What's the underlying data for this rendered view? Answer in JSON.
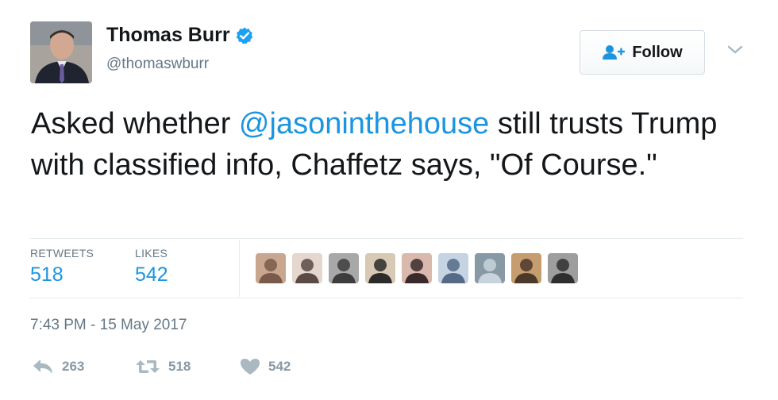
{
  "author": {
    "name": "Thomas Burr",
    "handle": "@thomaswburr",
    "verified": true,
    "verified_color": "#1da1f2"
  },
  "follow_button": {
    "label": "Follow",
    "icon": "add-user-icon"
  },
  "tweet": {
    "text_before": "Asked whether ",
    "mention": "@jasoninthehouse",
    "text_after": " still trusts Trump with classified info, Chaffetz says, \"Of Course.\""
  },
  "stats": {
    "retweets_label": "RETWEETS",
    "retweets_value": "518",
    "likes_label": "LIKES",
    "likes_value": "542"
  },
  "likers": [
    {
      "name": "liker-avatar-1",
      "colors": [
        "#7a5a4a",
        "#c9a78f"
      ]
    },
    {
      "name": "liker-avatar-2",
      "colors": [
        "#5b4a45",
        "#e5d6ce"
      ]
    },
    {
      "name": "liker-avatar-3",
      "colors": [
        "#3d3d3d",
        "#a8a8a8"
      ]
    },
    {
      "name": "liker-avatar-4",
      "colors": [
        "#2b2b2b",
        "#d8c9b5"
      ]
    },
    {
      "name": "liker-avatar-5",
      "colors": [
        "#3a2b2b",
        "#d9b8ad"
      ]
    },
    {
      "name": "liker-avatar-6",
      "colors": [
        "#546a86",
        "#c6d3e2"
      ]
    },
    {
      "name": "liker-avatar-7",
      "colors": [
        "#c9d3db",
        "#8899a6"
      ]
    },
    {
      "name": "liker-avatar-8",
      "colors": [
        "#4b3a2c",
        "#c59d6f"
      ]
    },
    {
      "name": "liker-avatar-9",
      "colors": [
        "#2f2f2f",
        "#9e9e9e"
      ]
    }
  ],
  "timestamp": "7:43 PM - 15 May 2017",
  "actions": {
    "reply_count": "263",
    "retweet_count": "518",
    "like_count": "542"
  },
  "colors": {
    "accent": "#1b95e0",
    "muted": "#657786",
    "action_gray": "#8899a6"
  }
}
